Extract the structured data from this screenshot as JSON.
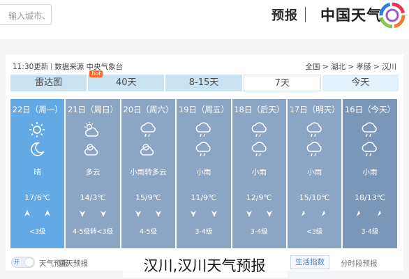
{
  "header": {
    "search_placeholder": "输入城市、",
    "forecast_link": "预报",
    "brand_name": "中国天气"
  },
  "meta": {
    "update_time": "11:30更新",
    "data_source": "数据来源 中央气象台",
    "breadcrumb": [
      "全国",
      "湖北",
      "孝感",
      "汉川"
    ],
    "breadcrumb_sep": ">"
  },
  "tabs": [
    {
      "label": "今天"
    },
    {
      "label": "7天"
    },
    {
      "label": "8-15天"
    },
    {
      "label": "40天",
      "badge": "hot"
    },
    {
      "label": "雷达图"
    }
  ],
  "colors": {
    "col_dark": "#7b97b8",
    "col_mid": "#8aa6c4",
    "col_today": "#62a9e6",
    "tab_bg": "#c9e3f3",
    "brand_blue": "#2a7dd8"
  },
  "days": [
    {
      "date": "16日（今天）",
      "cond": "小雨",
      "temp": "18/13℃",
      "wind": "3-4级",
      "icons": [
        "cloud-rain-icon",
        "cloud-rain-icon"
      ],
      "wind_dir": [
        "sw",
        "sw"
      ]
    },
    {
      "date": "17日（明天）",
      "cond": "小雨",
      "temp": "15/10℃",
      "wind": "<3级",
      "icons": [
        "cloud-rain-icon",
        "cloud-rain-icon"
      ],
      "wind_dir": [
        "sw",
        "sw"
      ]
    },
    {
      "date": "18日（后天）",
      "cond": "小雨",
      "temp": "12/9℃",
      "wind": "3-4级",
      "icons": [
        "cloud-rain-icon",
        "cloud-rain-icon"
      ],
      "wind_dir": [
        "s",
        "s"
      ]
    },
    {
      "date": "19日（周五）",
      "cond": "小雨",
      "temp": "11/9℃",
      "wind": "3-4级",
      "icons": [
        "cloud-rain-icon",
        "cloud-rain-icon"
      ],
      "wind_dir": [
        "s",
        "s"
      ]
    },
    {
      "date": "20日（周六）",
      "cond": "小雨转多云",
      "temp": "15/9℃",
      "wind": "4-5级",
      "icons": [
        "cloud-rain-icon",
        "partly-cloudy-icon"
      ],
      "wind_dir": [
        "s",
        "s"
      ]
    },
    {
      "date": "21日（周日）",
      "cond": "多云",
      "temp": "14/3℃",
      "wind": "4-5级转<3级",
      "icons": [
        "partly-cloudy-sun-icon",
        "partly-cloudy-icon"
      ],
      "wind_dir": [
        "s",
        "s"
      ]
    },
    {
      "date": "22日（周一）",
      "cond": "晴",
      "temp": "17/6℃",
      "wind": "<3级",
      "icons": [
        "sun-icon",
        "moon-icon"
      ],
      "wind_dir": [
        "n",
        "n"
      ]
    }
  ],
  "bottom": {
    "toggle_on_label": "开",
    "reminder_label": "天气预报",
    "blue_sky_label": "蓝天预报",
    "plain_button": "生活指数",
    "hourly_button": "分时段预报"
  },
  "caption": "汉川,汉川天气预报"
}
